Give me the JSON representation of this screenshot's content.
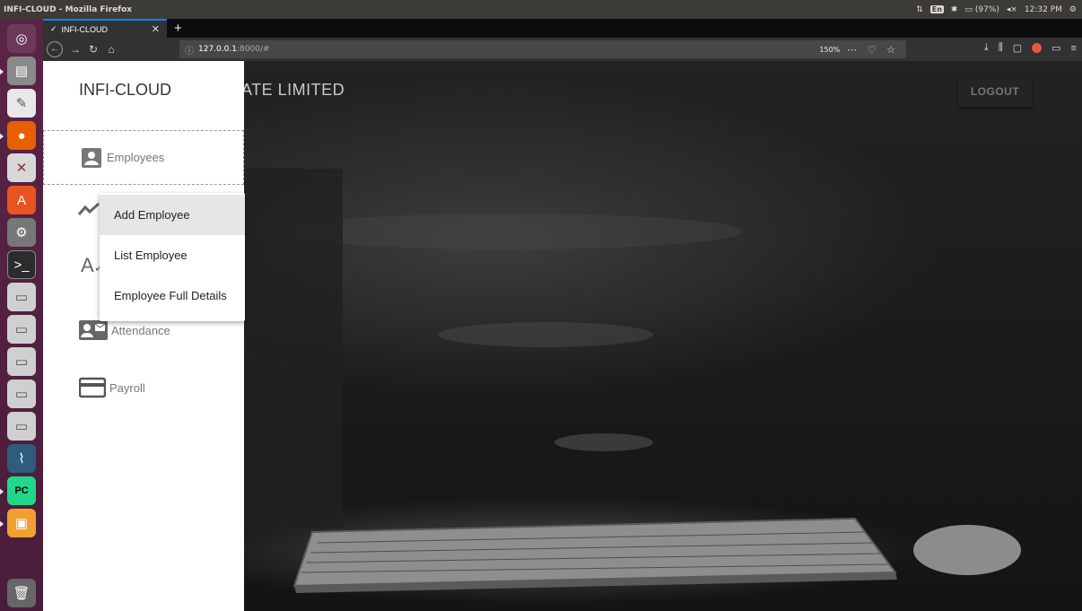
{
  "os": {
    "window_title": "INFI-CLOUD - Mozilla Firefox",
    "indicators": {
      "keyboard": "En",
      "battery": "(97%)",
      "time": "12:32 PM"
    }
  },
  "browser": {
    "tab_title": "INFI-CLOUD",
    "url_host": "127.0.0.1",
    "url_rest": ":8000/#",
    "zoom": "150%"
  },
  "app": {
    "brand": "INFI-CLOUD",
    "page_title": "ATE LIMITED",
    "logout_label": "LOGOUT",
    "nav": {
      "employees": "Employees",
      "attendance": "Attendance",
      "payroll": "Payroll"
    },
    "menu": [
      "Add Employee",
      "List Employee",
      "Employee Full Details"
    ]
  }
}
